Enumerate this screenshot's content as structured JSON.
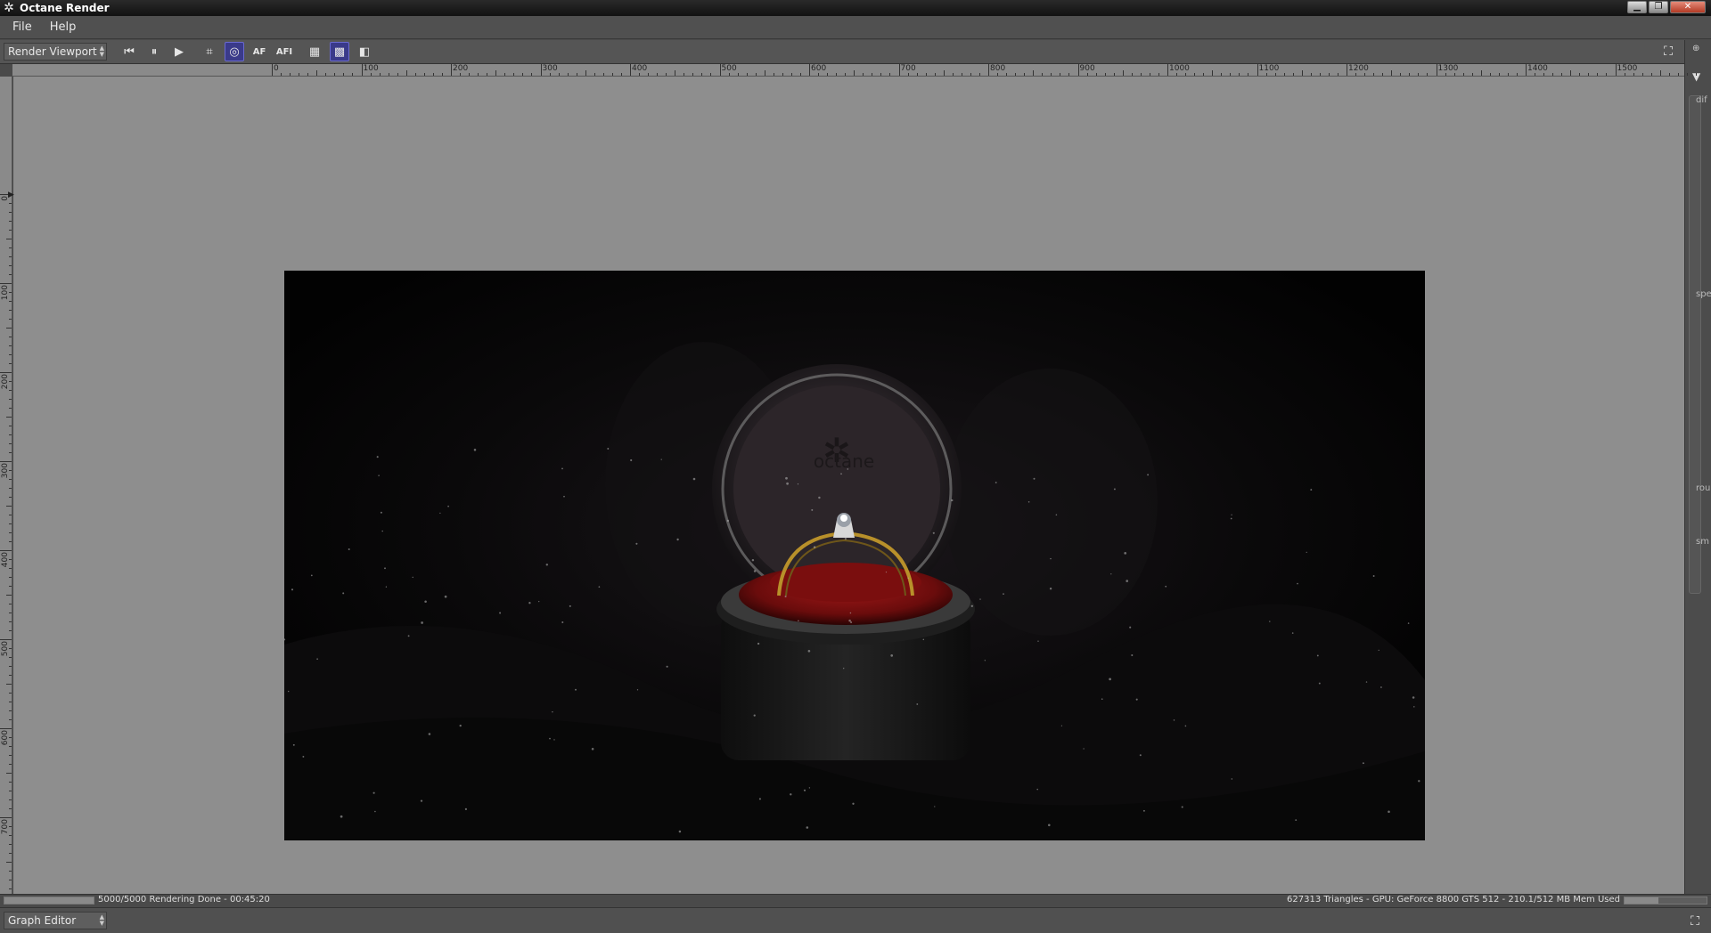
{
  "window": {
    "title": "Octane Render",
    "app_icon": "octane-logo-icon",
    "controls": [
      "minimize-icon",
      "restore-icon",
      "close-icon"
    ]
  },
  "menu": {
    "items": [
      {
        "label": "File"
      },
      {
        "label": "Help"
      }
    ]
  },
  "toolbar": {
    "viewport_select": "Render Viewport",
    "buttons": [
      {
        "icon": "restart-icon",
        "glyph": "⏮",
        "active": false
      },
      {
        "icon": "pause-icon",
        "glyph": "⏸",
        "active": false
      },
      {
        "icon": "play-icon",
        "glyph": "▶",
        "active": false
      },
      {
        "icon": "region-icon",
        "glyph": "⌗",
        "active": false
      },
      {
        "icon": "focus-picker-icon",
        "glyph": "◎",
        "active": true
      },
      {
        "icon": "autofocus-icon",
        "glyph": "AF",
        "active": false
      },
      {
        "icon": "autofocus-pick-icon",
        "glyph": "AFI",
        "active": false
      },
      {
        "icon": "background-solid-icon",
        "glyph": "▦",
        "active": false
      },
      {
        "icon": "background-checker-icon",
        "glyph": "▩",
        "active": true
      },
      {
        "icon": "background-toggle-icon",
        "glyph": "◧",
        "active": false
      }
    ],
    "fullscreen_icon": "fullscreen-icon"
  },
  "ruler": {
    "h_labels": [
      "0",
      "100",
      "200",
      "300",
      "400",
      "500",
      "600",
      "700",
      "800",
      "900",
      "1000",
      "1100",
      "1200",
      "1300",
      "1400",
      "1500"
    ],
    "v_labels": [
      "0",
      "100",
      "200",
      "300",
      "400",
      "500",
      "600",
      "700"
    ]
  },
  "right_panel": {
    "labels": [
      "dif",
      "spe",
      "rou",
      "sm"
    ]
  },
  "render": {
    "watermark": "octane"
  },
  "status": {
    "left_text": "5000/5000 Rendering Done - 00:45:20",
    "right_text": "627313 Triangles - GPU: GeForce 8800 GTS 512 - 210.1/512 MB Mem Used",
    "progress": 1.0,
    "mem_fraction": 0.41
  },
  "bottom_panel": {
    "editor_select": "Graph Editor"
  }
}
